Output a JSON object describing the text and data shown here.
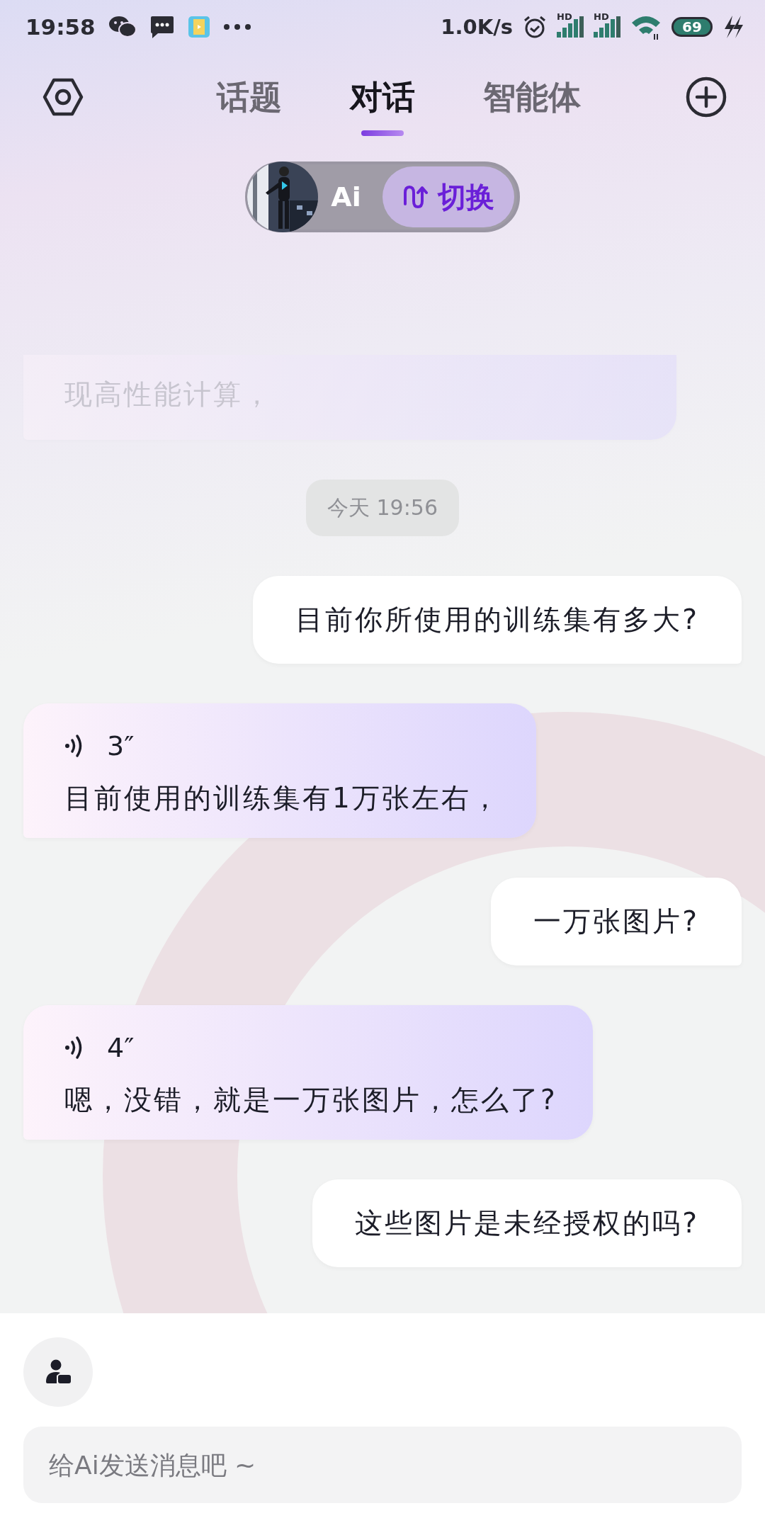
{
  "status_bar": {
    "time": "19:58",
    "network_speed": "1.0K/s",
    "signal_labels": [
      "HD",
      "HD"
    ],
    "battery": "69"
  },
  "tabs": [
    {
      "label": "话题",
      "selected": false
    },
    {
      "label": "对话",
      "selected": true
    },
    {
      "label": "智能体",
      "selected": false
    }
  ],
  "agent_switch": {
    "name": "Ai",
    "button": "切换"
  },
  "messages": [
    {
      "kind": "ai_partial",
      "text": "现高性能计算，"
    },
    {
      "kind": "time",
      "text": "今天 19:56"
    },
    {
      "kind": "user",
      "text": "目前你所使用的训练集有多大?"
    },
    {
      "kind": "ai_voice",
      "duration": "3″",
      "text": "目前使用的训练集有1万张左右，"
    },
    {
      "kind": "user",
      "text": "一万张图片?"
    },
    {
      "kind": "ai_voice",
      "duration": "4″",
      "text": "嗯，没错，就是一万张图片，怎么了?"
    },
    {
      "kind": "user",
      "text": "这些图片是未经授权的吗?"
    }
  ],
  "input": {
    "placeholder": "给Ai发送消息吧 ~"
  }
}
